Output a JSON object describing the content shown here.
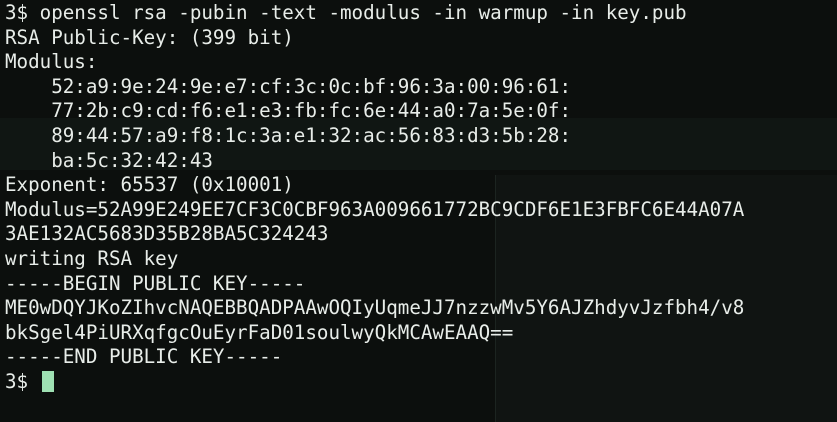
{
  "terminal": {
    "lines": [
      "3$ openssl rsa -pubin -text -modulus -in warmup -in key.pub",
      "RSA Public-Key: (399 bit)",
      "Modulus:",
      "    52:a9:9e:24:9e:e7:cf:3c:0c:bf:96:3a:00:96:61:",
      "    77:2b:c9:cd:f6:e1:e3:fb:fc:6e:44:a0:7a:5e:0f:",
      "    89:44:57:a9:f8:1c:3a:e1:32:ac:56:83:d3:5b:28:",
      "    ba:5c:32:42:43",
      "Exponent: 65537 (0x10001)",
      "Modulus=52A99E249EE7CF3C0CBF963A009661772BC9CDF6E1E3FBFC6E44A07A",
      "3AE132AC5683D35B28BA5C324243",
      "writing RSA key",
      "-----BEGIN PUBLIC KEY-----",
      "ME0wDQYJKoZIhvcNAQEBBQADPAAwOQIyUqmeJJ7nzzwMv5Y6AJZhdyvJzfbh4/v8",
      "bkSgel4PiURXqfgcOuEyrFaD01soulwyQkMCAwEAAQ==",
      "-----END PUBLIC KEY-----",
      "3$ "
    ],
    "cursor_color": "#9ee0b2",
    "text_color": "#e8ede9",
    "background": "#0c0f0d"
  }
}
